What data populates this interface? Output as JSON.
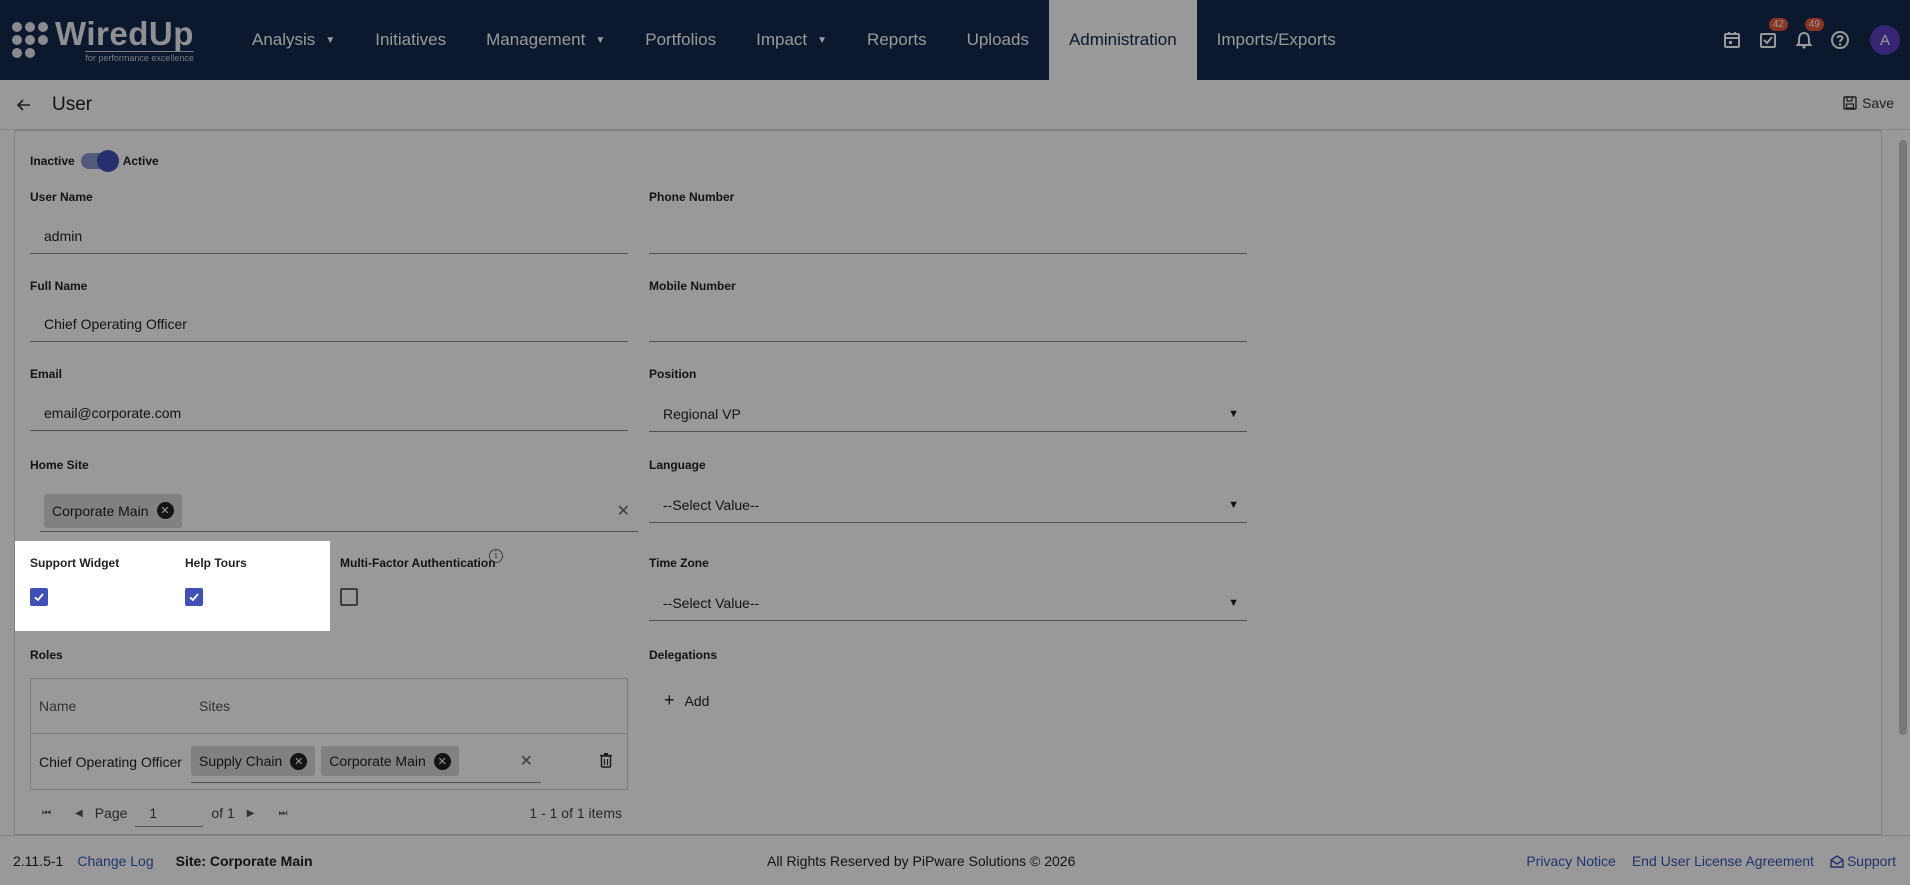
{
  "nav": {
    "logo_text": "WiredUp",
    "logo_tagline": "for performance excellence",
    "items": [
      {
        "label": "Analysis",
        "caret": true
      },
      {
        "label": "Initiatives",
        "caret": false
      },
      {
        "label": "Management",
        "caret": true
      },
      {
        "label": "Portfolios",
        "caret": false
      },
      {
        "label": "Impact",
        "caret": true
      },
      {
        "label": "Reports",
        "caret": false
      },
      {
        "label": "Uploads",
        "caret": false
      },
      {
        "label": "Administration",
        "caret": false,
        "active": true
      },
      {
        "label": "Imports/Exports",
        "caret": false
      }
    ],
    "tasks_badge": "42",
    "notifications_badge": "49",
    "avatar_initial": "A"
  },
  "header": {
    "title": "User",
    "save_label": "Save"
  },
  "form": {
    "status": {
      "inactive_label": "Inactive",
      "active_label": "Active",
      "active": true
    },
    "user_name": {
      "label": "User Name",
      "value": "admin"
    },
    "phone": {
      "label": "Phone Number",
      "value": ""
    },
    "full_name": {
      "label": "Full Name",
      "value": "Chief Operating Officer"
    },
    "mobile": {
      "label": "Mobile Number",
      "value": ""
    },
    "email": {
      "label": "Email",
      "value": "email@corporate.com"
    },
    "position": {
      "label": "Position",
      "value": "Regional VP"
    },
    "home_site": {
      "label": "Home Site",
      "chip": "Corporate Main"
    },
    "language": {
      "label": "Language",
      "value": "--Select Value--"
    },
    "support_widget": {
      "label": "Support Widget",
      "checked": true
    },
    "help_tours": {
      "label": "Help Tours",
      "checked": true
    },
    "mfa": {
      "label": "Multi-Factor Authentication",
      "checked": false
    },
    "time_zone": {
      "label": "Time Zone",
      "value": "--Select Value--"
    },
    "roles": {
      "label": "Roles",
      "columns": [
        "Name",
        "Sites"
      ],
      "rows": [
        {
          "name": "Chief Operating Officer",
          "sites": [
            "Supply Chain",
            "Corporate Main"
          ]
        }
      ],
      "pager": {
        "page_label": "Page",
        "page": "1",
        "of_label": "of 1",
        "summary": "1 - 1 of 1 items"
      }
    },
    "delegations": {
      "label": "Delegations",
      "add_label": "Add"
    }
  },
  "footer": {
    "version": "2.11.5-1",
    "changelog": "Change Log",
    "site": "Site: Corporate Main",
    "copyright": "All Rights Reserved by PiPware Solutions © 2026",
    "privacy": "Privacy Notice",
    "eula": "End User License Agreement",
    "support": "Support"
  }
}
